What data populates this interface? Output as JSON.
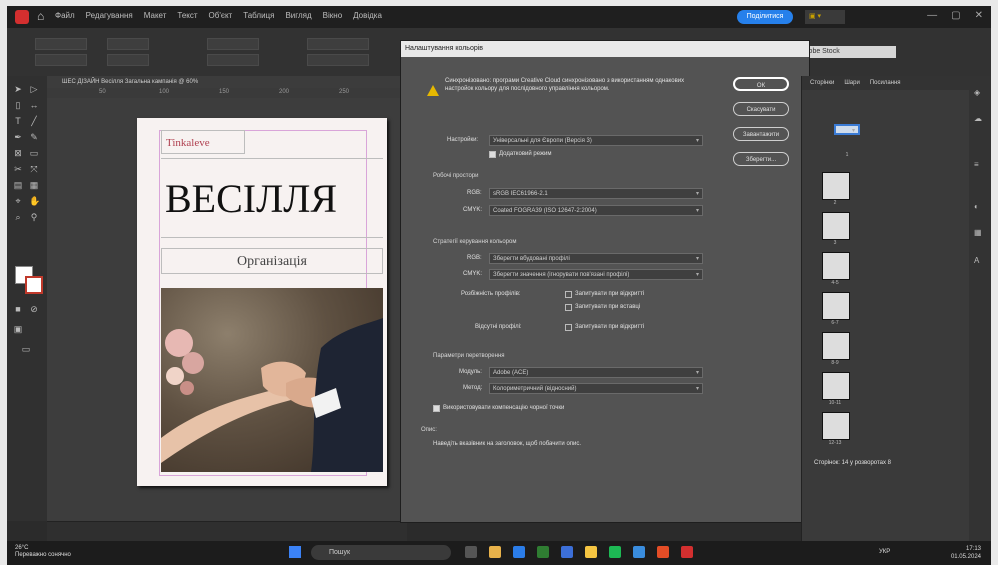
{
  "app": {
    "menus": [
      "Файл",
      "Редагування",
      "Макет",
      "Текст",
      "Об'єкт",
      "Таблиця",
      "Вигляд",
      "Вікно",
      "Довідка"
    ],
    "share_label": "Поділитися",
    "search_placeholder": "Adobe Stock"
  },
  "document": {
    "tab_title": "ШЕС ДІЗАЙН Весілля Загальна кампанія @ 60%",
    "ruler_ticks": [
      "50",
      "100",
      "150",
      "200",
      "250"
    ],
    "brand": "Tinkaleve",
    "title": "ВЕСІЛЛЯ",
    "subtitle": "Організація"
  },
  "dialog": {
    "title": "Налаштування кольорів",
    "warning": "Синхронізовано: програми Creative Cloud синхронізовано з використанням однакових настройок кольору для послідовного управління кольором.",
    "buttons": {
      "ok": "ОК",
      "cancel": "Скасувати",
      "load": "Завантажити",
      "save": "Зберегти..."
    },
    "settings_label": "Настройки:",
    "settings_value": "Універсальні для Європи (Версія 3)",
    "advanced_label": "Додатковий режим",
    "working_spaces_title": "Робочі простори",
    "rgb_label": "RGB:",
    "rgb_value": "sRGB IEC61966-2.1",
    "cmyk_label": "CMYK:",
    "cmyk_value": "Coated FOGRA39 (ISO 12647-2:2004)",
    "policies_title": "Стратегії керування кольором",
    "policy_rgb_label": "RGB:",
    "policy_rgb_value": "Зберегти вбудовані профілі",
    "policy_cmyk_label": "CMYK:",
    "policy_cmyk_value": "Зберегти значення (ігнорувати пов'язані профілі)",
    "mismatch_label": "Розбіжність профілів:",
    "ask_open_label": "Запитувати при відкритті",
    "ask_paste_label": "Запитувати при вставці",
    "missing_label": "Відсутні профілі:",
    "ask_open_missing_label": "Запитувати при відкритті",
    "conversion_title": "Параметри перетворення",
    "engine_label": "Модуль:",
    "engine_value": "Adobe (ACE)",
    "intent_label": "Метод:",
    "intent_value": "Колориметричний (відносний)",
    "bpc_label": "Використовувати компенсацію чорної точки",
    "description_title": "Опис:",
    "description_text": "Наведіть вказівник на заголовок, щоб побачити опис."
  },
  "pages_panel": {
    "tabs": [
      "Сторінки",
      "Шари",
      "Посилання"
    ],
    "footer": "Сторінок: 14 у розворотах 8",
    "numbers": [
      "1",
      "2",
      "3",
      "4-5",
      "6-7",
      "8-9",
      "10-11",
      "12-13"
    ]
  },
  "taskbar": {
    "weather_temp": "26°C",
    "weather_text": "Переважно сонячно",
    "search": "Пошук",
    "time": "17:13",
    "date": "01.05.2024",
    "lang": "УКР"
  }
}
